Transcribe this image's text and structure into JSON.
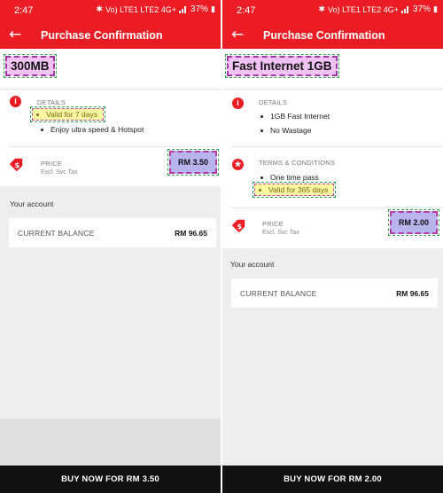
{
  "status": {
    "time": "2:47",
    "icons_text": "Vo) LTE1 LTE2 4G+",
    "battery": "37%"
  },
  "icons": {
    "back": "arrow-left-icon",
    "info": "info-icon",
    "star": "star-icon",
    "price_tag": "price-tag-icon"
  },
  "colors": {
    "brand_red": "#ec1c24",
    "headline_highlight": "#f3c2f5",
    "bullet_highlight": "#faf7a3",
    "price_highlight": "#b8b4ee",
    "buy_bar": "#111111"
  },
  "left": {
    "appbar_title": "Purchase Confirmation",
    "plan_name": "300MB",
    "details_label": "DETAILS",
    "details": [
      "Valid for 7 days",
      "Enjoy ultra speed & Hotspot"
    ],
    "price_label": "PRICE",
    "price_sub": "Excl. Svc Tax",
    "price_value": "RM 3.50",
    "account_title": "Your account",
    "balance_label": "CURRENT BALANCE",
    "balance_value": "RM 96.65",
    "buy_label": "BUY NOW FOR RM 3.50"
  },
  "right": {
    "appbar_title": "Purchase Confirmation",
    "plan_name": "Fast Internet 1GB",
    "details_label": "DETAILS",
    "details": [
      "1GB Fast Internet",
      "No Wastage"
    ],
    "terms_label": "TERMS & CONDITIONS",
    "terms": [
      "One time pass",
      "Valid for 365 days"
    ],
    "price_label": "PRICE",
    "price_sub": "Excl. Svc Tax",
    "price_value": "RM 2.00",
    "account_title": "Your account",
    "balance_label": "CURRENT BALANCE",
    "balance_value": "RM 96.65",
    "buy_label": "BUY NOW FOR RM 2.00"
  }
}
